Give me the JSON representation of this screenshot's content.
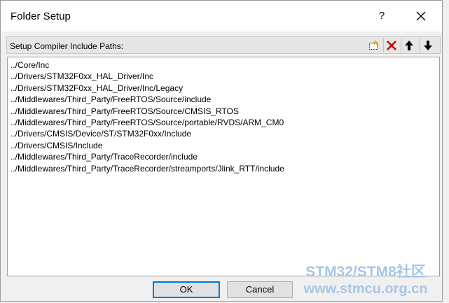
{
  "window": {
    "title": "Folder Setup",
    "help_label": "?"
  },
  "section": {
    "label": "Setup Compiler Include Paths:"
  },
  "include_paths": [
    "../Core/Inc",
    "../Drivers/STM32F0xx_HAL_Driver/Inc",
    "../Drivers/STM32F0xx_HAL_Driver/Inc/Legacy",
    "../Middlewares/Third_Party/FreeRTOS/Source/include",
    "../Middlewares/Third_Party/FreeRTOS/Source/CMSIS_RTOS",
    "../Middlewares/Third_Party/FreeRTOS/Source/portable/RVDS/ARM_CM0",
    "../Drivers/CMSIS/Device/ST/STM32F0xx/Include",
    "../Drivers/CMSIS/Include",
    "../Middlewares/Third_Party/TraceRecorder/include",
    "../Middlewares/Third_Party/TraceRecorder/streamports/Jlink_RTT/include"
  ],
  "buttons": {
    "ok": "OK",
    "cancel": "Cancel"
  },
  "watermark": {
    "line1": "STM32/STM8社区",
    "line2": "www.stmcu.org.cn"
  },
  "colors": {
    "delete_red": "#c00000",
    "accent_blue": "#0078d7"
  }
}
